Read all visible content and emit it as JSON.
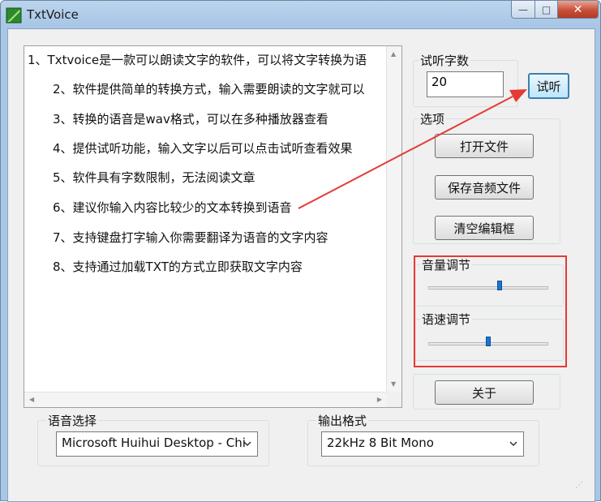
{
  "window": {
    "title": "TxtVoice",
    "minimize_glyph": "—",
    "maximize_glyph": "□",
    "close_glyph": "✕"
  },
  "text_lines": [
    "1、Txtvoice是一款可以朗读文字的软件，可以将文字转换为语",
    "2、软件提供简单的转换方式，输入需要朗读的文字就可以",
    "3、转换的语音是wav格式，可以在多种播放器查看",
    "4、提供试听功能，输入文字以后可以点击试听查看效果",
    "5、软件具有字数限制，无法阅读文章",
    "6、建议你输入内容比较少的文本转换到语音",
    "7、支持键盘打字输入你需要翻译为语音的文字内容",
    "8、支持通过加载TXT的方式立即获取文字内容"
  ],
  "preview": {
    "group_label": "试听字数",
    "count_value": "20",
    "preview_button": "试听"
  },
  "options": {
    "group_label": "选项",
    "open_file": "打开文件",
    "save_audio": "保存音频文件",
    "clear_editor": "清空编辑框"
  },
  "adjust": {
    "volume_label": "音量调节",
    "volume_level": 0.6,
    "speed_label": "语速调节",
    "speed_level": 0.5
  },
  "about_button": "关于",
  "voice": {
    "group_label": "语音选择",
    "selected": "Microsoft Huihui Desktop - Chi"
  },
  "output": {
    "group_label": "输出格式",
    "selected": "22kHz 8 Bit Mono"
  },
  "annotation_color": "#e53a35",
  "icons": {
    "app": "app-green-icon",
    "chevron": "chevron-down-icon"
  }
}
